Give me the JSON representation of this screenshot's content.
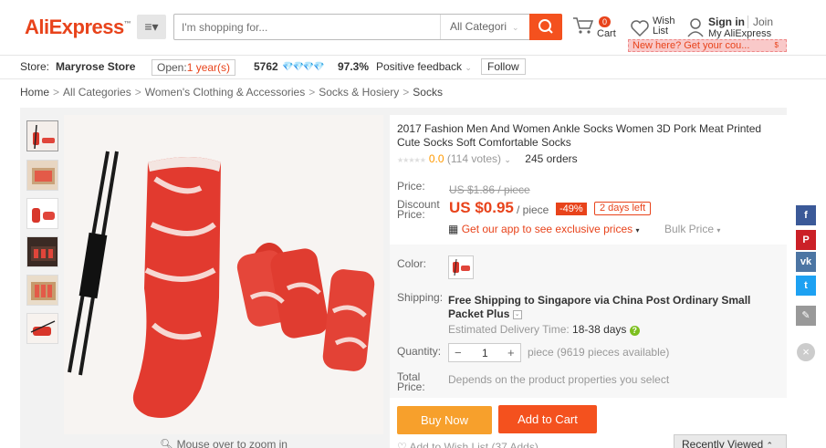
{
  "header": {
    "logo": "AliExpress",
    "logo_mark": "™",
    "search_placeholder": "I'm shopping for...",
    "category_select": "All Categori",
    "cart_count": "0",
    "cart_label": "Cart",
    "wish_label": "Wish List",
    "sign_in": "Sign in",
    "join": "Join",
    "my_account": "My AliExpress",
    "promo": "New here? Get your cou...",
    "promo_close": "$"
  },
  "store": {
    "label": "Store:",
    "name": "Maryrose Store",
    "open_prefix": "Open:",
    "open_years": "1 year(s)",
    "score": "5762",
    "diamonds": "💎💎💎💎",
    "feedback_pct": "97.3%",
    "feedback_label": "Positive feedback",
    "follow": "Follow"
  },
  "breadcrumb": [
    "Home",
    "All Categories",
    "Women's Clothing & Accessories",
    "Socks & Hosiery",
    "Socks"
  ],
  "gallery": {
    "zoom_hint": "Mouse over to zoom in"
  },
  "product": {
    "title": "2017 Fashion Men And Women Ankle Socks Women 3D Pork Meat Printed Cute Socks Soft Comfortable Socks",
    "rating_score": "0.0",
    "votes": "(114 votes)",
    "orders": "245 orders",
    "price_label": "Price:",
    "old_price": "US $1.86 / piece",
    "discount_label_1": "Discount",
    "discount_label_2": "Price:",
    "new_price": "US $0.95",
    "per_piece": "/ piece",
    "discount_pct": "-49%",
    "days_left": "2 days left",
    "app_link": "Get our app to see exclusive prices",
    "bulk": "Bulk Price",
    "color_label": "Color:",
    "shipping_label": "Shipping:",
    "shipping_text": "Free Shipping to Singapore via China Post Ordinary Small Packet Plus",
    "eta_label": "Estimated Delivery Time:",
    "eta_days": "18-38 days",
    "quantity_label": "Quantity:",
    "quantity_value": "1",
    "qty_available": "piece (9619 pieces available)",
    "total_label_1": "Total",
    "total_label_2": "Price:",
    "total_value": "Depends on the product properties you select",
    "buy_now": "Buy Now",
    "add_to_cart": "Add to Cart",
    "add_wishlist": "Add to Wish List (37 Adds)",
    "recently_viewed": "Recently Viewed"
  },
  "colors": {
    "brand": "#e8431b",
    "buy": "#f7a02c",
    "cart": "#f4511e"
  }
}
